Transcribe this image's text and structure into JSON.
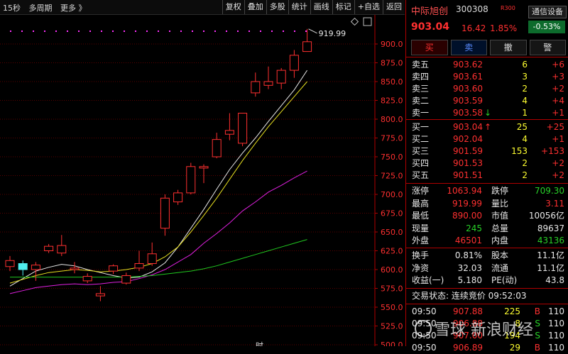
{
  "toolbar": {
    "left": [
      "15秒",
      "多周期",
      "更多 》"
    ],
    "buttons": [
      "复权",
      "叠加",
      "多股",
      "统计",
      "画线",
      "标记",
      "+自选",
      "返回"
    ]
  },
  "chart": {
    "y_ticks": [
      "900.0",
      "875.0",
      "850.0",
      "825.0",
      "800.0",
      "775.0",
      "750.0",
      "725.0",
      "700.0",
      "675.0",
      "650.0",
      "625.0",
      "600.0",
      "575.0",
      "550.0",
      "525.0",
      "500.0"
    ],
    "high_label": "919.99",
    "bottom_label": "时"
  },
  "chart_data": {
    "type": "candlestick",
    "ylim": [
      500,
      925
    ],
    "candles": [
      {
        "o": 604,
        "c": 612,
        "h": 618,
        "l": 598
      },
      {
        "o": 608,
        "c": 600,
        "h": 612,
        "l": 592
      },
      {
        "o": 600,
        "c": 606,
        "h": 610,
        "l": 585
      },
      {
        "o": 625,
        "c": 631,
        "h": 634,
        "l": 622
      },
      {
        "o": 622,
        "c": 632,
        "h": 646,
        "l": 618
      },
      {
        "o": 600,
        "c": 602,
        "h": 610,
        "l": 595
      },
      {
        "o": 585,
        "c": 591,
        "h": 595,
        "l": 582
      },
      {
        "o": 565,
        "c": 568,
        "h": 578,
        "l": 558
      },
      {
        "o": 598,
        "c": 605,
        "h": 607,
        "l": 594
      },
      {
        "o": 582,
        "c": 592,
        "h": 596,
        "l": 580
      },
      {
        "o": 602,
        "c": 608,
        "h": 625,
        "l": 598
      },
      {
        "o": 608,
        "c": 621,
        "h": 636,
        "l": 605
      },
      {
        "o": 655,
        "c": 695,
        "h": 700,
        "l": 645
      },
      {
        "o": 690,
        "c": 702,
        "h": 706,
        "l": 686
      },
      {
        "o": 702,
        "c": 737,
        "h": 742,
        "l": 700
      },
      {
        "o": 735,
        "c": 737,
        "h": 740,
        "l": 715
      },
      {
        "o": 750,
        "c": 773,
        "h": 782,
        "l": 748
      },
      {
        "o": 780,
        "c": 785,
        "h": 808,
        "l": 772
      },
      {
        "o": 768,
        "c": 808,
        "h": 808,
        "l": 764
      },
      {
        "o": 835,
        "c": 850,
        "h": 862,
        "l": 830
      },
      {
        "o": 845,
        "c": 850,
        "h": 870,
        "l": 840
      },
      {
        "o": 848,
        "c": 865,
        "h": 868,
        "l": 840
      },
      {
        "o": 865,
        "c": 885,
        "h": 892,
        "l": 855
      },
      {
        "o": 890,
        "c": 903,
        "h": 920,
        "l": 890
      }
    ],
    "ma": [
      {
        "color": "#e8e8e8",
        "values": [
          578,
          588,
          598,
          603,
          607,
          605,
          600,
          596,
          592,
          589,
          590,
          597,
          609,
          630,
          655,
          680,
          707,
          733,
          755,
          775,
          797,
          818,
          839,
          865
        ]
      },
      {
        "color": "#e8e020",
        "values": [
          582,
          587,
          592,
          596,
          598,
          600,
          599,
          597,
          598,
          600,
          603,
          608,
          617,
          630,
          650,
          672,
          695,
          720,
          745,
          768,
          790,
          810,
          830,
          850
        ]
      },
      {
        "color": "#e020e0",
        "values": [
          568,
          572,
          576,
          578,
          580,
          581,
          580,
          581,
          583,
          584,
          588,
          593,
          600,
          610,
          620,
          635,
          648,
          662,
          678,
          690,
          703,
          712,
          722,
          731
        ]
      },
      {
        "color": "#20c820",
        "values": [
          590,
          590,
          590,
          590,
          590,
          590,
          590,
          590,
          590,
          590,
          591,
          592,
          594,
          596,
          598,
          601,
          605,
          610,
          615,
          620,
          625,
          630,
          635,
          640
        ]
      }
    ],
    "dotted_line": 917
  },
  "panel": {
    "stock_name": "中际旭创",
    "stock_code": "300308",
    "r_badge": "R300",
    "settings_button": "通信设备",
    "change_box": "-0.53%",
    "price": "903.04",
    "change": "16.42",
    "change_pct": "1.85%",
    "trade_buttons": [
      "买",
      "卖",
      "撤",
      "警"
    ],
    "asks": [
      {
        "label": "卖五",
        "price": "903.62",
        "vol": "6",
        "delta": "+6"
      },
      {
        "label": "卖四",
        "price": "903.61",
        "vol": "3",
        "delta": "+3"
      },
      {
        "label": "卖三",
        "price": "903.60",
        "vol": "2",
        "delta": "+2"
      },
      {
        "label": "卖二",
        "price": "903.59",
        "vol": "4",
        "delta": "+4"
      },
      {
        "label": "卖一",
        "price": "903.58",
        "arrow": "↓",
        "vol": "1",
        "delta": "+1"
      }
    ],
    "bids": [
      {
        "label": "买一",
        "price": "903.04",
        "arrow": "↑",
        "vol": "25",
        "delta": "+25"
      },
      {
        "label": "买二",
        "price": "902.04",
        "vol": "4",
        "delta": "+1"
      },
      {
        "label": "买三",
        "price": "901.59",
        "vol": "153",
        "delta": "+153"
      },
      {
        "label": "买四",
        "price": "901.53",
        "vol": "2",
        "delta": "+2"
      },
      {
        "label": "买五",
        "price": "901.51",
        "vol": "2",
        "delta": "+2"
      }
    ],
    "stats": [
      {
        "l1": "涨停",
        "v1": "1063.94",
        "c1": "r",
        "l2": "跌停",
        "v2": "709.30",
        "c2": "g"
      },
      {
        "l1": "最高",
        "v1": "919.99",
        "c1": "r",
        "l2": "量比",
        "v2": "3.11",
        "c2": "r"
      },
      {
        "l1": "最低",
        "v1": "890.00",
        "c1": "r",
        "l2": "市值",
        "v2": "10056亿",
        "c2": "w"
      },
      {
        "l1": "现量",
        "v1": "245",
        "c1": "g",
        "l2": "总量",
        "v2": "89637",
        "c2": "w"
      },
      {
        "l1": "外盘",
        "v1": "46501",
        "c1": "r",
        "l2": "内盘",
        "v2": "43136",
        "c2": "g"
      }
    ],
    "stats2": [
      {
        "l1": "换手",
        "v1": "0.81%",
        "l2": "股本",
        "v2": "11.1亿"
      },
      {
        "l1": "净资",
        "v1": "32.03",
        "l2": "流通",
        "v2": "11.1亿"
      },
      {
        "l1": "收益(一)",
        "v1": "5.180",
        "l2": "PE(动)",
        "v2": "43.8"
      }
    ],
    "trade_status": "交易状态: 连续竞价 09:52:03",
    "ticks": [
      {
        "time": "09:50",
        "price": "907.88",
        "vol": "225",
        "flag": "B",
        "num": "110"
      },
      {
        "time": "09:50",
        "price": "906.88",
        "vol": "8",
        "flag": "S",
        "num": "110"
      },
      {
        "time": "09:50",
        "price": "907.00",
        "vol": "194",
        "flag": "S",
        "num": "110"
      },
      {
        "time": "09:50",
        "price": "906.89",
        "vol": "29",
        "flag": "B",
        "num": "110"
      }
    ],
    "watermark": "雪球 新浪财经"
  }
}
